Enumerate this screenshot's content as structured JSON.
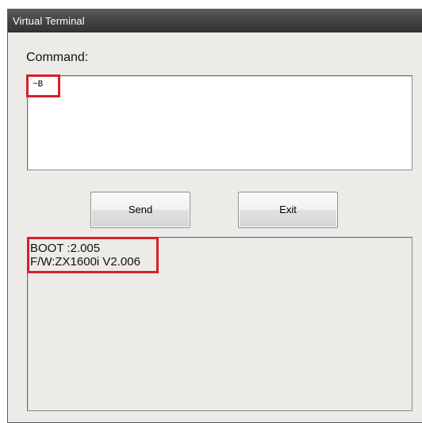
{
  "window": {
    "title": "Virtual Terminal"
  },
  "command": {
    "label": "Command:",
    "value": "~B"
  },
  "buttons": {
    "send_label": "Send",
    "exit_label": "Exit"
  },
  "output": {
    "lines": [
      "BOOT :2.005",
      "F/W:ZX1600i V2.006"
    ]
  },
  "colors": {
    "highlight": "#d52127",
    "window_bg": "#ecebe8",
    "titlebar": "#444444"
  }
}
